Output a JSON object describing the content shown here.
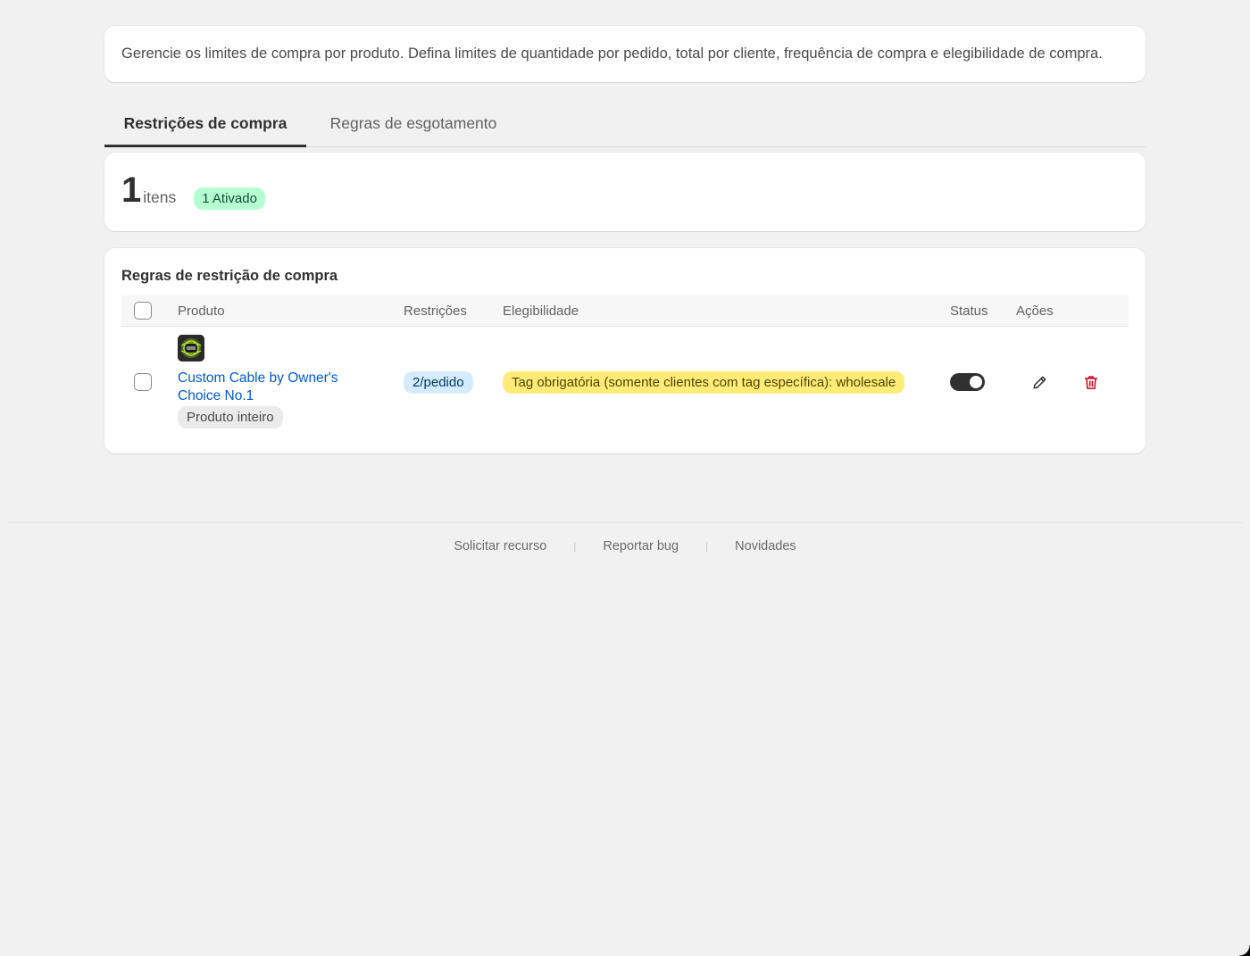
{
  "description": "Gerencie os limites de compra por produto. Defina limites de quantidade por pedido, total por cliente, frequência de compra e elegibilidade de compra.",
  "tabs": [
    {
      "label": "Restrições de compra",
      "selected": true
    },
    {
      "label": "Regras de esgotamento",
      "selected": false
    }
  ],
  "summary": {
    "count": "1",
    "unit": "itens",
    "active_badge": "1 Ativado"
  },
  "rules": {
    "title": "Regras de restrição de compra",
    "columns": {
      "product": "Produto",
      "restrictions": "Restrições",
      "eligibility": "Elegibilidade",
      "status": "Status",
      "actions": "Ações"
    },
    "rows": [
      {
        "product_name": "Custom Cable by Owner's Choice No.1",
        "scope": "Produto inteiro",
        "limit": "2/pedido",
        "eligibility": "Tag obrigatória (somente clientes com tag específica): wholesale",
        "enabled": true
      }
    ]
  },
  "footer": {
    "links": [
      "Solicitar recurso",
      "Reportar bug",
      "Novidades"
    ]
  },
  "colors": {
    "link": "#005bd3",
    "active_badge_bg": "#b4fed2",
    "limit_badge_bg": "#d5ebff",
    "tag_badge_bg": "#ffeb78",
    "delete": "#c70a24"
  }
}
